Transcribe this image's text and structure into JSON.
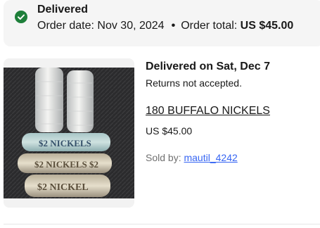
{
  "status": {
    "title": "Delivered",
    "order_date_label": "Order date:",
    "order_date": "Nov 30, 2024",
    "separator": "•",
    "order_total_label": "Order total:",
    "order_total": "US $45.00",
    "icon": "check-circle-icon",
    "accent_color": "#1e7f3a"
  },
  "item": {
    "delivered_on": "Delivered on Sat, Dec 7",
    "returns": "Returns not accepted.",
    "title": "180 BUFFALO NICKELS",
    "price": "US $45.00",
    "sold_by_label": "Sold by:",
    "seller": "mautil_4242",
    "image_text": {
      "roll_label_1": "$2 NICKELS",
      "roll_label_2": "$2 NICKELS $2",
      "roll_label_3": "$2 NICKEL"
    }
  }
}
